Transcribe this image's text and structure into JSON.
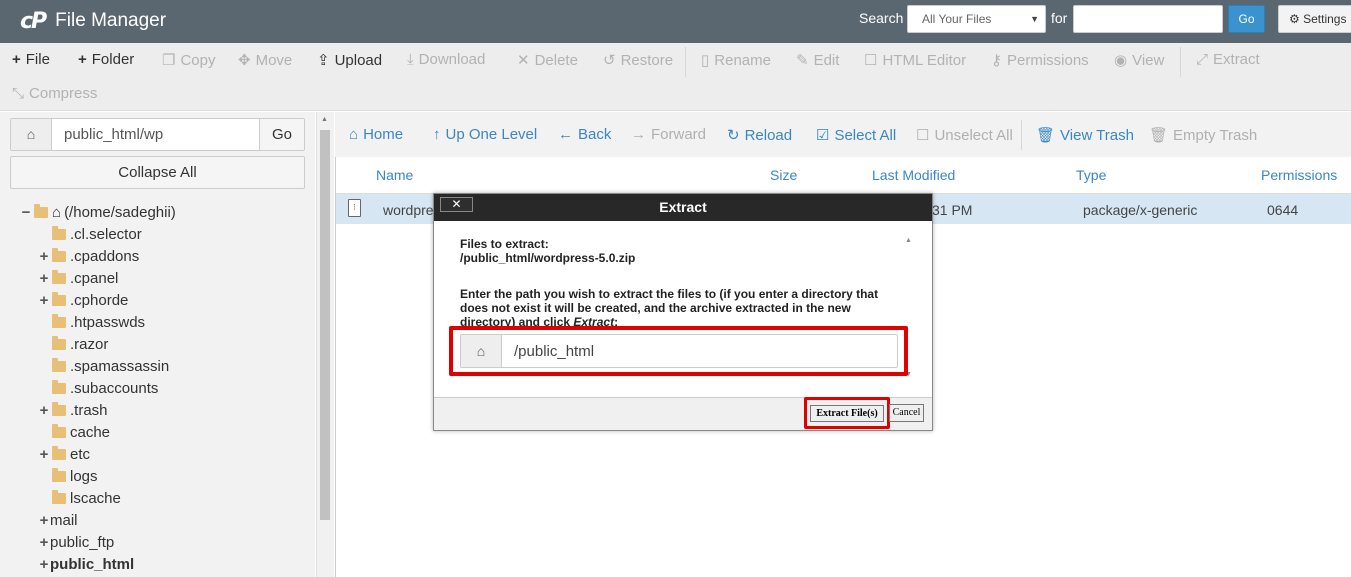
{
  "header": {
    "logo": "cP",
    "title": "File Manager",
    "search_label": "Search",
    "search_scope": "All Your Files",
    "for_label": "for",
    "search_value": "",
    "go_label": "Go",
    "settings_label": "Settings"
  },
  "toolbar": {
    "file": "File",
    "folder": "Folder",
    "copy": "Copy",
    "move": "Move",
    "upload": "Upload",
    "download": "Download",
    "delete": "Delete",
    "restore": "Restore",
    "rename": "Rename",
    "edit": "Edit",
    "html_editor": "HTML Editor",
    "permissions": "Permissions",
    "view": "View",
    "extract": "Extract",
    "compress": "Compress"
  },
  "left": {
    "path": "public_html/wp",
    "go_label": "Go",
    "collapse_label": "Collapse All",
    "tree": [
      {
        "label": "(/home/sadeghii)",
        "expander": "−"
      },
      {
        "label": ".cl.selector",
        "expander": ""
      },
      {
        "label": ".cpaddons",
        "expander": "+"
      },
      {
        "label": ".cpanel",
        "expander": "+"
      },
      {
        "label": ".cphorde",
        "expander": "+"
      },
      {
        "label": ".htpasswds",
        "expander": ""
      },
      {
        "label": ".razor",
        "expander": ""
      },
      {
        "label": ".spamassassin",
        "expander": ""
      },
      {
        "label": ".subaccounts",
        "expander": ""
      },
      {
        "label": ".trash",
        "expander": "+"
      },
      {
        "label": "cache",
        "expander": ""
      },
      {
        "label": "etc",
        "expander": "+"
      },
      {
        "label": "logs",
        "expander": ""
      },
      {
        "label": "lscache",
        "expander": ""
      },
      {
        "label": "mail",
        "expander": "+"
      },
      {
        "label": "public_ftp",
        "expander": "+"
      },
      {
        "label": "public_html",
        "expander": "+"
      }
    ]
  },
  "nav": {
    "home": "Home",
    "up_one_level": "Up One Level",
    "back": "Back",
    "forward": "Forward",
    "reload": "Reload",
    "select_all": "Select All",
    "unselect_all": "Unselect All",
    "view_trash": "View Trash",
    "empty_trash": "Empty Trash"
  },
  "table": {
    "columns": {
      "name": "Name",
      "size": "Size",
      "modified": "Last Modified",
      "type": "Type",
      "permissions": "Permissions"
    },
    "rows": [
      {
        "name": "wordpre",
        "modified": "31 PM",
        "type": "package/x-generic",
        "permissions": "0644"
      }
    ]
  },
  "dialog": {
    "title": "Extract",
    "close_label": "✕",
    "files_label": "Files to extract:",
    "file_path": "/public_html/wordpress-5.0.zip",
    "instructions_a": "Enter the path you wish to extract the files to (if you enter a directory that does not exist it will be created, and the archive extracted in the new directory) and click ",
    "instructions_em": "Extract",
    "instructions_b": ":",
    "destination": "/public_html",
    "extract_label": "Extract File(s)",
    "cancel_label": "Cancel"
  },
  "colors": {
    "header_bg": "#5b6770",
    "link_blue": "#3a87c4",
    "highlight_red": "#e00000",
    "selected_row": "#d7e6f3"
  }
}
